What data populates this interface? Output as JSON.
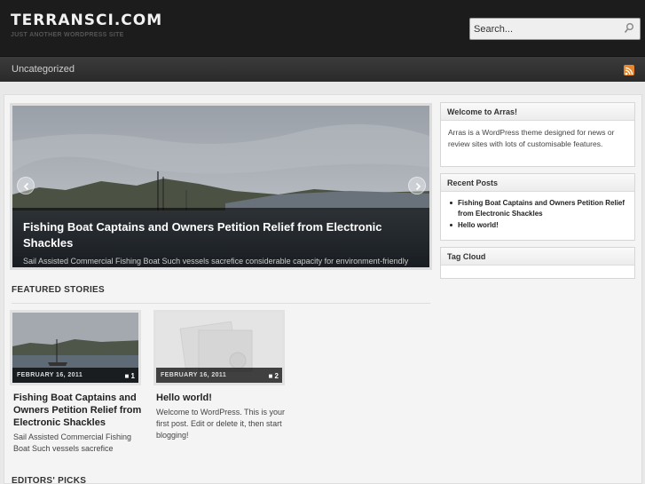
{
  "header": {
    "site_title": "TERRANSCI.COM",
    "tagline": "JUST ANOTHER WORDPRESS SITE",
    "search_placeholder": "Search..."
  },
  "nav": {
    "items": [
      {
        "label": "Uncategorized"
      }
    ],
    "rss_icon": "rss-feed-icon"
  },
  "slideshow": {
    "title": "Fishing Boat Captains and Owners Petition Relief from Electronic Shackles",
    "excerpt": "Sail Assisted Commercial Fishing Boat Such vessels sacrefice considerable capacity for environment-friendly",
    "prev_icon": "chevron-left-icon",
    "next_icon": "chevron-right-icon"
  },
  "featured": {
    "heading": "FEATURED STORIES",
    "posts": [
      {
        "date": "FEBRUARY 16, 2011",
        "comments": "1",
        "title": "Fishing Boat Captains and Owners Petition Relief from Electronic Shackles",
        "excerpt": "Sail Assisted Commercial Fishing Boat Such vessels sacrefice"
      },
      {
        "date": "FEBRUARY 16, 2011",
        "comments": "2",
        "title": "Hello world!",
        "excerpt": "Welcome to WordPress. This is your first post. Edit or delete it, then start blogging!"
      }
    ]
  },
  "editors": {
    "heading": "EDITORS' PICKS"
  },
  "sidebar": {
    "welcome": {
      "title": "Welcome to Arras!",
      "body": "Arras is a WordPress theme designed for news or review sites with lots of customisable features."
    },
    "recent": {
      "title": "Recent Posts",
      "items": [
        "Fishing Boat Captains and Owners Petition Relief from Electronic Shackles",
        "Hello world!"
      ]
    },
    "tagcloud": {
      "title": "Tag Cloud"
    }
  },
  "colors": {
    "header_bg": "#1c1c1c",
    "nav_bg": "#333333",
    "rss": "#e8862b",
    "page_bg": "#f4f4f4"
  }
}
